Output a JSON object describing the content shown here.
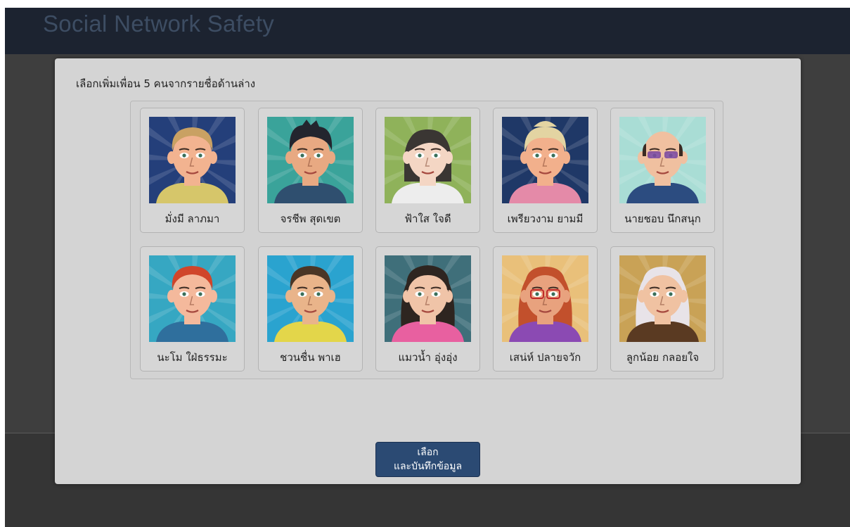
{
  "app": {
    "title": "Social Network Safety"
  },
  "dialog": {
    "prompt": "เลือกเพิ่มเพื่อน 5 คนจากรายชื่อด้านล่าง",
    "submit_line1": "เลือก",
    "submit_line2": "และบันทึกข้อมูล"
  },
  "friends": [
    {
      "name": "มั่งมี ลาภมา",
      "bg": "#243f7a",
      "skin": "#f2b390",
      "hair": "#c9a163",
      "shirt": "#d6c66a",
      "hair_style": "short"
    },
    {
      "name": "จรชีพ สุดเขต",
      "bg": "#3aa39a",
      "skin": "#e8a982",
      "hair": "#23252e",
      "shirt": "#2f4f6f",
      "hair_style": "spiky"
    },
    {
      "name": "ฟ้าใส ใจดี",
      "bg": "#8fb25a",
      "skin": "#f4d6c4",
      "hair": "#3a3633",
      "shirt": "#ededed",
      "hair_style": "bob"
    },
    {
      "name": "เพรียวงาม ยามมี",
      "bg": "#1f3867",
      "skin": "#f2b08c",
      "hair": "#e3d4a2",
      "shirt": "#e48aa8",
      "hair_style": "updo"
    },
    {
      "name": "นายชอบ นึกสนุก",
      "bg": "#a9ddd5",
      "skin": "#f0c0a0",
      "hair": "#3a2a22",
      "shirt": "#2c4c80",
      "hair_style": "bald"
    },
    {
      "name": "นะโม ใฝ่ธรรมะ",
      "bg": "#36a7c2",
      "skin": "#f4b99c",
      "hair": "#d0452a",
      "shirt": "#2f6f9d",
      "hair_style": "short"
    },
    {
      "name": "ชวนชื่น พาเฮ",
      "bg": "#2aa3cf",
      "skin": "#e9b48a",
      "hair": "#4a3626",
      "shirt": "#e3d64a",
      "hair_style": "short"
    },
    {
      "name": "แมวน้ำ อุ่งอุ่ง",
      "bg": "#3f6f7a",
      "skin": "#f0c4a8",
      "hair": "#2e2520",
      "shirt": "#e860a0",
      "hair_style": "curly"
    },
    {
      "name": "เสน่ห์ ปลายจวัก",
      "bg": "#e9c07a",
      "skin": "#e8a27e",
      "hair": "#c2502c",
      "shirt": "#8b4ab3",
      "hair_style": "long"
    },
    {
      "name": "ลูกน้อย กลอยใจ",
      "bg": "#c9a256",
      "skin": "#f0c2a2",
      "hair": "#e8e3e8",
      "shirt": "#5a3a22",
      "hair_style": "long"
    }
  ]
}
